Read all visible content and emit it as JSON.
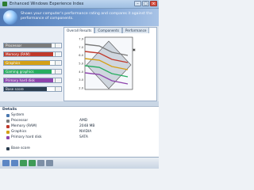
{
  "window": {
    "title": "Enhanced Windows Experience Index",
    "btn_minimize": "–",
    "btn_maximize": "□",
    "btn_close": "×"
  },
  "banner": {
    "description": "Shows your computer's performance rating and compares it against the performance of components."
  },
  "scores": [
    {
      "label": "Processor",
      "color": "#7a7a7a"
    },
    {
      "label": "Memory (RAM)",
      "color": "#c0392b"
    },
    {
      "label": "Graphics",
      "color": "#d4a017"
    },
    {
      "label": "Gaming graphics",
      "color": "#27ae60"
    },
    {
      "label": "Primary hard disk",
      "color": "#8e44ad"
    },
    {
      "label": "Base score",
      "color": "#2c3e50"
    }
  ],
  "tabs": [
    "Overall Results",
    "Components",
    "Performance"
  ],
  "chart_data": {
    "type": "line",
    "y_ticks": [
      "7.9",
      "7.0",
      "6.0",
      "5.0",
      "4.0",
      "3.0",
      "2.0"
    ],
    "series": [
      {
        "color": "#7a7a7a"
      },
      {
        "color": "#c0392b"
      },
      {
        "color": "#d4a017"
      },
      {
        "color": "#27ae60"
      },
      {
        "color": "#8e44ad"
      }
    ]
  },
  "details": {
    "header": "Details",
    "rows": [
      {
        "label": "System",
        "value": ""
      },
      {
        "label": "Processor",
        "value": "AMD"
      },
      {
        "label": "Memory (RAM)",
        "value": "2048 MB"
      },
      {
        "label": "Graphics",
        "value": "NVIDIA"
      },
      {
        "label": "Primary hard disk",
        "value": "SATA"
      },
      {
        "label": "Base score",
        "value": ""
      }
    ]
  },
  "toolbar": {
    "buttons": [
      "back-icon",
      "forward-icon",
      "refresh-icon",
      "play-icon",
      "save-icon",
      "help-icon"
    ]
  }
}
